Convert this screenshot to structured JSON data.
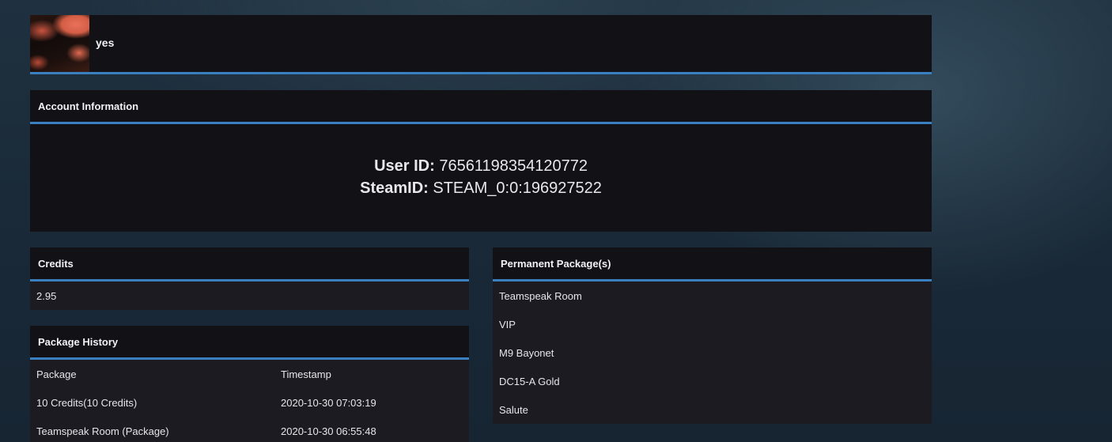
{
  "profile": {
    "username": "yes"
  },
  "account": {
    "title": "Account Information",
    "user_id_label": "User ID:",
    "user_id_value": "76561198354120772",
    "steam_id_label": "SteamID:",
    "steam_id_value": "STEAM_0:0:196927522"
  },
  "credits": {
    "title": "Credits",
    "value": "2.95"
  },
  "permanent_packages": {
    "title": "Permanent Package(s)",
    "items": [
      "Teamspeak Room",
      "VIP",
      "M9 Bayonet",
      "DC15-A Gold",
      "Salute"
    ]
  },
  "package_history": {
    "title": "Package History",
    "columns": [
      "Package",
      "Timestamp"
    ],
    "rows": [
      [
        "10 Credits(10 Credits)",
        "2020-10-30 07:03:19"
      ],
      [
        "Teamspeak Room (Package)",
        "2020-10-30 06:55:48"
      ]
    ]
  },
  "colors": {
    "accent": "#3a80c1",
    "panel_header": "#111116",
    "panel_body": "#1b1b21"
  }
}
